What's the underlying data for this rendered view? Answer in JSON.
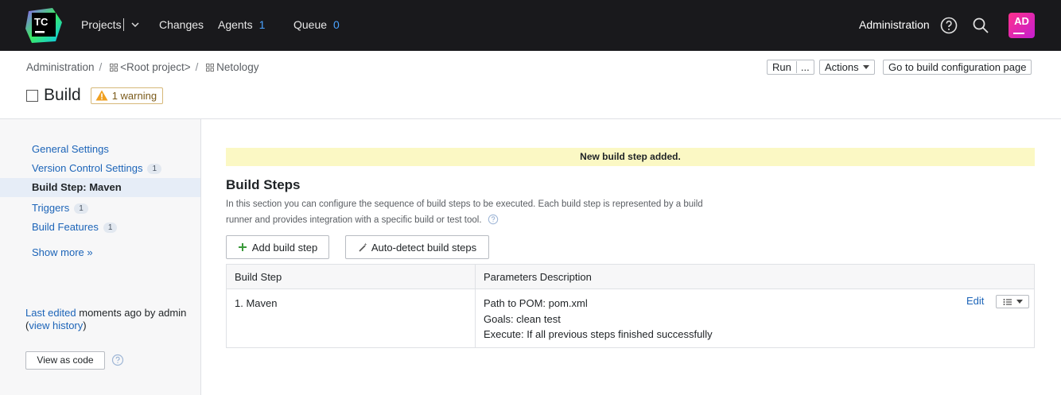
{
  "topbar": {
    "logo_text": "TC",
    "nav": [
      {
        "label": "Projects",
        "count": null
      },
      {
        "label": "Changes",
        "count": null
      },
      {
        "label": "Agents",
        "count": "1"
      },
      {
        "label": "Queue",
        "count": "0"
      }
    ],
    "admin_label": "Administration",
    "icons": [
      "help-icon",
      "search-icon"
    ],
    "avatar_initials": "AD"
  },
  "breadcrumbs": [
    "Administration",
    "<Root project>",
    "Netology"
  ],
  "page": {
    "title": "Build",
    "warning": "1 warning",
    "run_label": "Run",
    "run_more_label": "...",
    "actions_label": "Actions",
    "goto_label": "Go to build configuration page"
  },
  "sidebar": {
    "items": [
      {
        "label": "General Settings",
        "badge": null
      },
      {
        "label": "Version Control Settings",
        "badge": "1"
      },
      {
        "label": "Build Step: Maven",
        "badge": null
      },
      {
        "label": "Triggers",
        "badge": "1"
      },
      {
        "label": "Build Features",
        "badge": "1"
      }
    ],
    "show_more": "Show more »",
    "last_edited_link": "Last edited",
    "last_edited_text": "moments ago by admin",
    "view_history_open": "(",
    "view_history": "view history",
    "view_history_close": ")",
    "view_as_code": "View as code"
  },
  "main": {
    "notice": "New build step added.",
    "section_title": "Build Steps",
    "section_desc": "In this section you can configure the sequence of build steps to be executed. Each build step is represented by a build runner and provides integration with a specific build or test tool.",
    "add_step": "Add build step",
    "auto_detect": "Auto-detect build steps",
    "table": {
      "headers": [
        "Build Step",
        "Parameters Description"
      ],
      "rows": [
        {
          "step": "1. Maven",
          "params": [
            "Path to POM: pom.xml",
            "Goals: clean test",
            "Execute: If all previous steps finished successfully"
          ],
          "edit": "Edit"
        }
      ]
    }
  },
  "colors": {
    "topbar_bg": "#19191c",
    "link": "#1c64b8",
    "notice_bg": "#fbf8c4",
    "count": "#4aa3ff"
  }
}
